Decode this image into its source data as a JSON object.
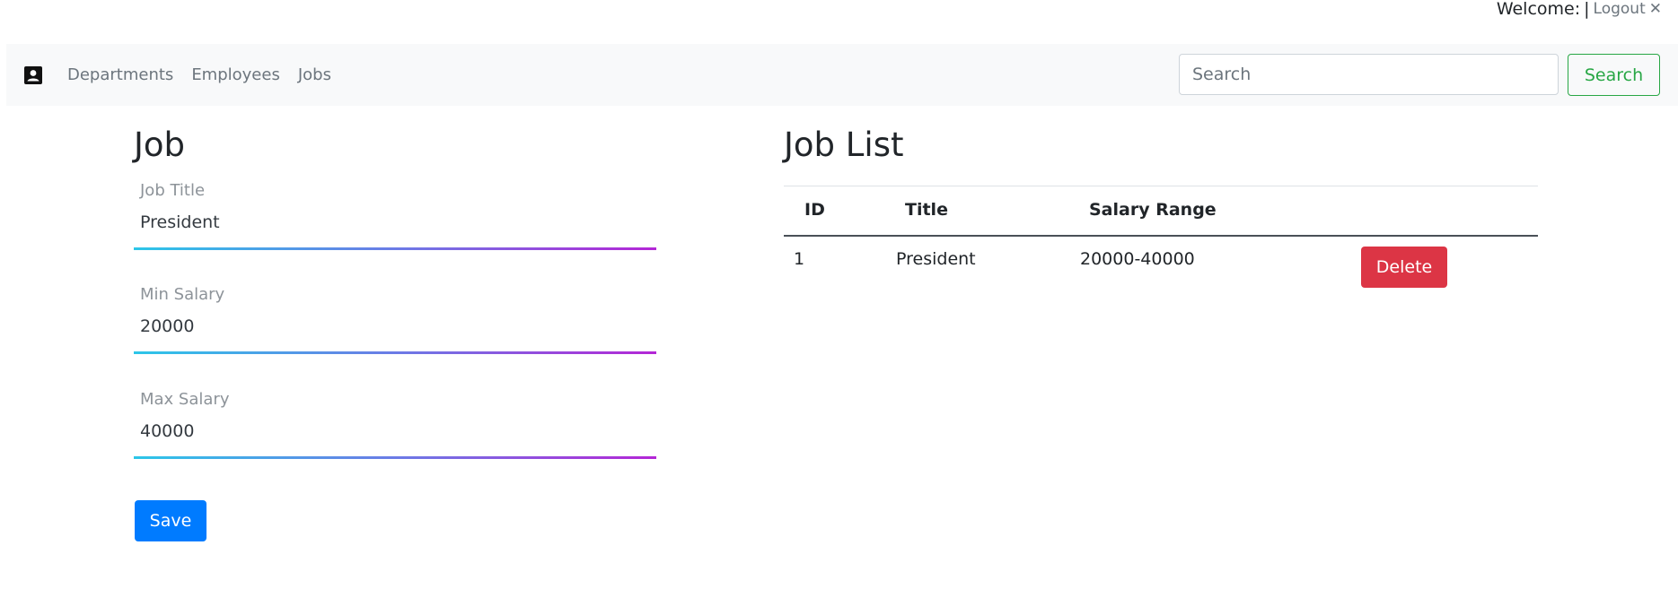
{
  "topbar": {
    "welcome": "Welcome:",
    "separator": "|",
    "logout": "Logout",
    "close_glyph": "✕"
  },
  "navbar": {
    "brand_icon": "contact-card-icon",
    "links": [
      "Departments",
      "Employees",
      "Jobs"
    ],
    "search": {
      "placeholder": "Search",
      "value": "",
      "button_label": "Search"
    },
    "colors": {
      "background": "#f8f9fa",
      "search_button": "#28a745"
    }
  },
  "form": {
    "heading": "Job",
    "fields": [
      {
        "label": "Job Title",
        "value": "President"
      },
      {
        "label": "Min Salary",
        "value": "20000"
      },
      {
        "label": "Max Salary",
        "value": "40000"
      }
    ],
    "save_label": "Save",
    "colors": {
      "underline_start": "#2cc6e8",
      "underline_end": "#b426d6",
      "save_button": "#007bff"
    }
  },
  "job_list": {
    "heading": "Job List",
    "columns": [
      "ID",
      "Title",
      "Salary Range",
      ""
    ],
    "rows": [
      {
        "id": "1",
        "title": "President",
        "salary_range": "20000-40000",
        "action_label": "Delete"
      }
    ],
    "colors": {
      "delete_button": "#dc3545"
    }
  }
}
